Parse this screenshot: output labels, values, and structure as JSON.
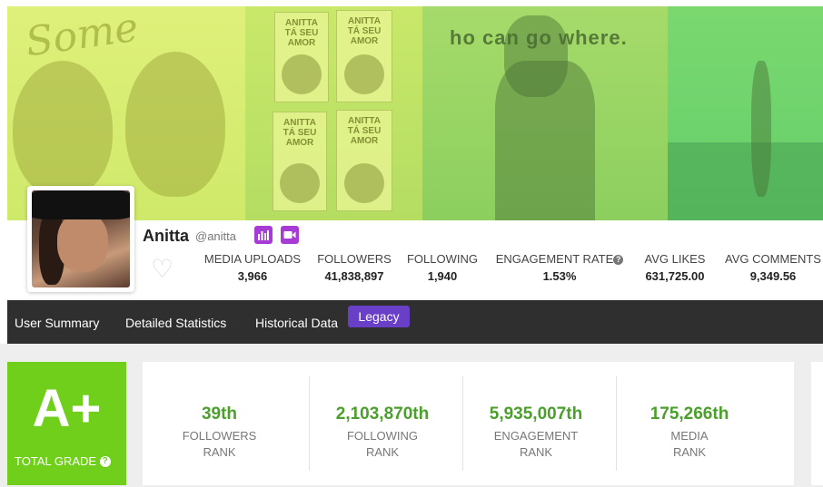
{
  "banner": {
    "script_text": "Some",
    "poster_text": "ANITTA\nTÁ SEU\nAMOR",
    "sign_text": "ho can go   where."
  },
  "profile": {
    "name": "Anitta",
    "handle": "@anitta",
    "badges": [
      "chart-icon",
      "video-icon"
    ],
    "badge_color": "#a63bd6"
  },
  "stats": [
    {
      "label": "MEDIA UPLOADS",
      "value": "3,966"
    },
    {
      "label": "FOLLOWERS",
      "value": "41,838,897"
    },
    {
      "label": "FOLLOWING",
      "value": "1,940"
    },
    {
      "label": "ENGAGEMENT RATE",
      "value": "1.53%"
    },
    {
      "label": "AVG LIKES",
      "value": "631,725.00"
    },
    {
      "label": "AVG COMMENTS",
      "value": "9,349.56"
    }
  ],
  "nav": {
    "items": [
      "User Summary",
      "Detailed Statistics",
      "Historical Data"
    ],
    "legacy": "Legacy",
    "legacy_color": "#6a3fc8"
  },
  "grade": {
    "value": "A+",
    "label": "TOTAL GRADE",
    "color": "#6fcf1a"
  },
  "ranks": [
    {
      "value": "39th",
      "label1": "FOLLOWERS",
      "label2": "RANK"
    },
    {
      "value": "2,103,870th",
      "label1": "FOLLOWING",
      "label2": "RANK"
    },
    {
      "value": "5,935,007th",
      "label1": "ENGAGEMENT",
      "label2": "RANK"
    },
    {
      "value": "175,266th",
      "label1": "MEDIA",
      "label2": "RANK"
    }
  ],
  "rank_color": "#4aa02b"
}
